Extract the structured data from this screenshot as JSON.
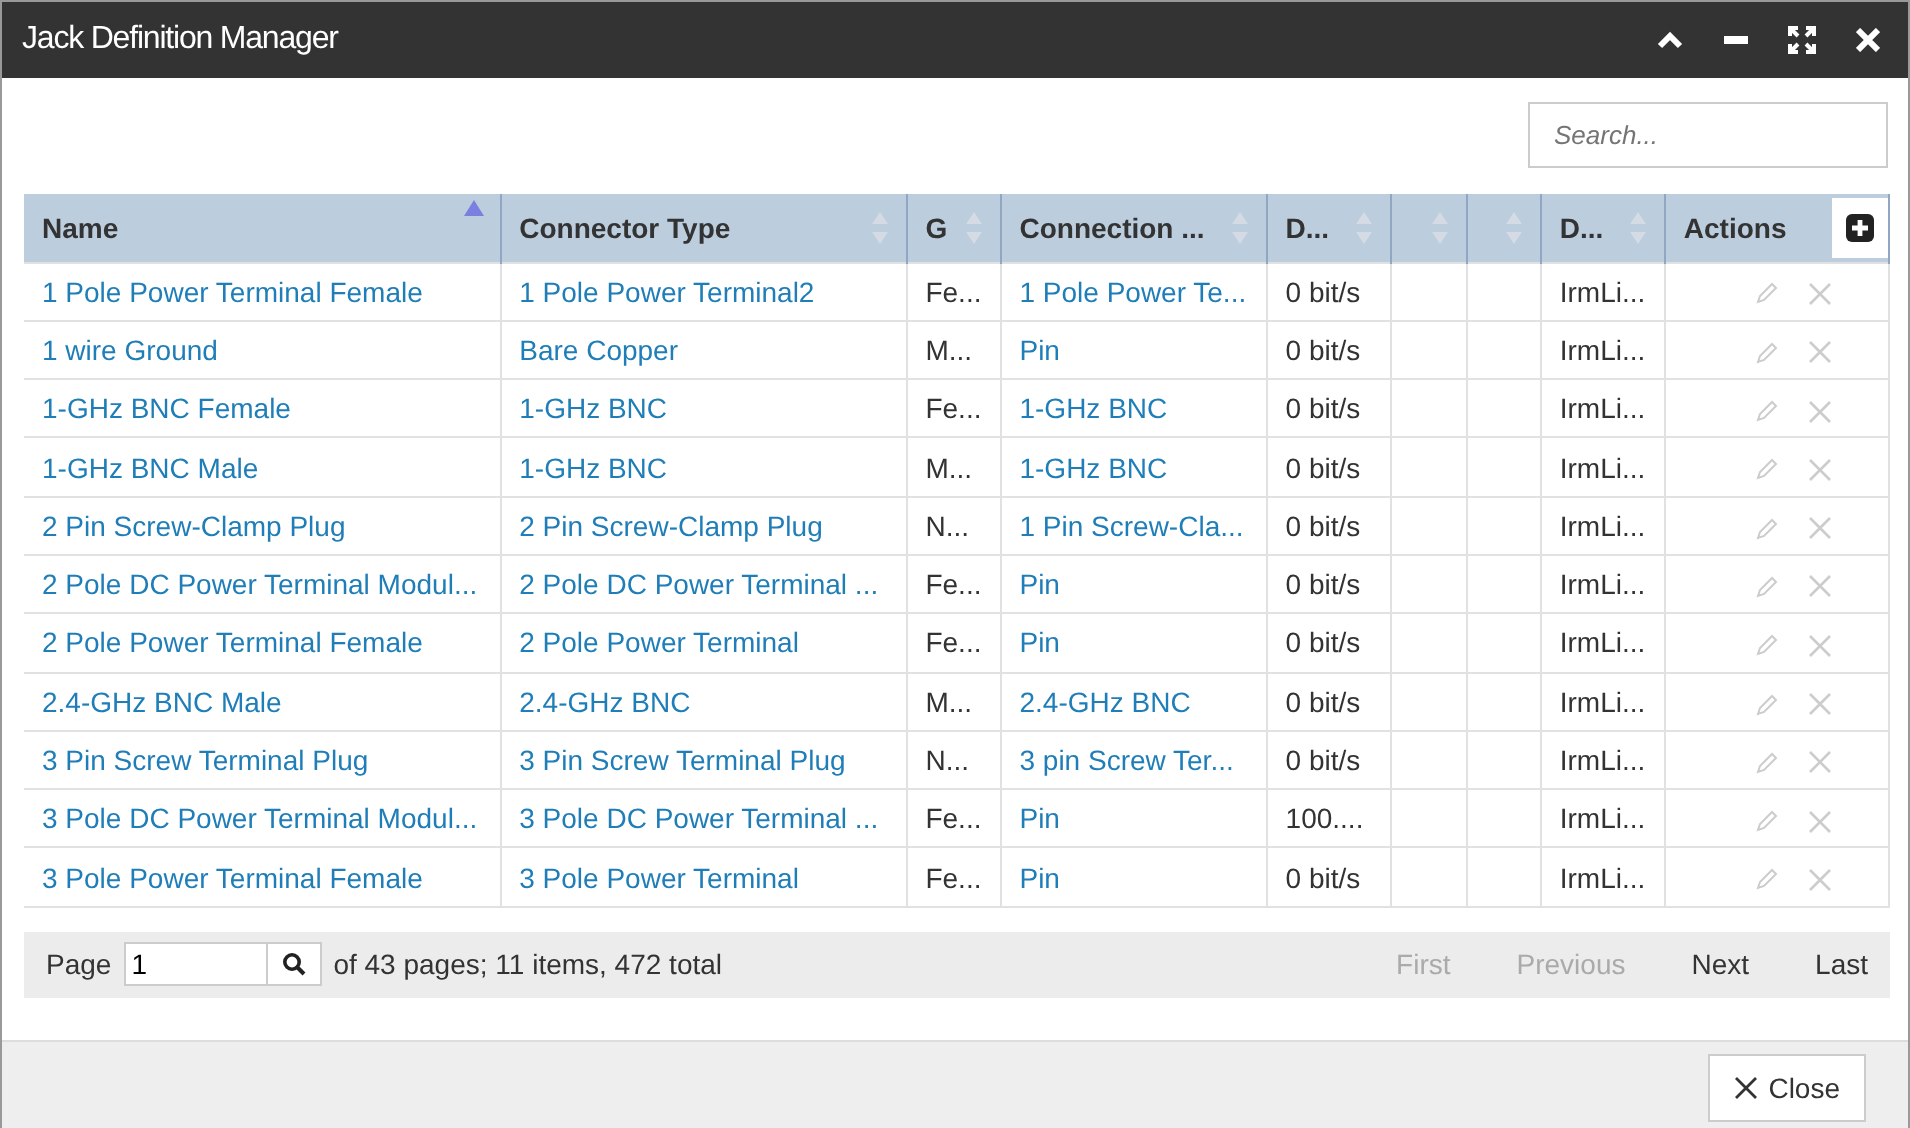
{
  "window": {
    "title": "Jack Definition Manager"
  },
  "search": {
    "placeholder": "Search..."
  },
  "table": {
    "columns": [
      {
        "label": "Name",
        "kind": "link",
        "sorted": true
      },
      {
        "label": "Connector Type",
        "kind": "link",
        "sorted": false
      },
      {
        "label": "G",
        "kind": "text",
        "sorted": false
      },
      {
        "label": "Connection ...",
        "kind": "link",
        "sorted": false
      },
      {
        "label": "D...",
        "kind": "text",
        "sorted": false
      },
      {
        "kind": "empty",
        "sorted": false
      },
      {
        "kind": "empty",
        "sorted": false
      },
      {
        "label": "D...",
        "kind": "text",
        "sorted": false
      },
      {
        "label": "Actions",
        "kind": "actions"
      }
    ],
    "rows": [
      {
        "cells": [
          "1 Pole Power Terminal Female",
          "1 Pole Power Terminal2",
          "Fe...",
          "1 Pole Power Te...",
          "0 bit/s",
          "IrmLi..."
        ]
      },
      {
        "cells": [
          "1 wire Ground",
          "Bare Copper",
          "M...",
          "Pin",
          "0 bit/s",
          "IrmLi..."
        ]
      },
      {
        "cells": [
          "1-GHz BNC Female",
          "1-GHz BNC",
          "Fe...",
          "1-GHz BNC",
          "0 bit/s",
          "IrmLi..."
        ]
      },
      {
        "cells": [
          "1-GHz BNC Male",
          "1-GHz BNC",
          "M...",
          "1-GHz BNC",
          "0 bit/s",
          "IrmLi..."
        ]
      },
      {
        "cells": [
          "2 Pin Screw-Clamp Plug",
          "2 Pin Screw-Clamp Plug",
          "N...",
          "1 Pin Screw-Cla...",
          "0 bit/s",
          "IrmLi..."
        ]
      },
      {
        "cells": [
          "2 Pole DC Power Terminal Modul...",
          "2 Pole DC Power Terminal ...",
          "Fe...",
          "Pin",
          "0 bit/s",
          "IrmLi..."
        ]
      },
      {
        "cells": [
          "2 Pole Power Terminal Female",
          "2 Pole Power Terminal",
          "Fe...",
          "Pin",
          "0 bit/s",
          "IrmLi..."
        ]
      },
      {
        "cells": [
          "2.4-GHz BNC Male",
          "2.4-GHz BNC",
          "M...",
          "2.4-GHz BNC",
          "0 bit/s",
          "IrmLi..."
        ]
      },
      {
        "cells": [
          "3 Pin Screw Terminal Plug",
          "3 Pin Screw Terminal Plug",
          "N...",
          "3 pin Screw Ter...",
          "0 bit/s",
          "IrmLi..."
        ]
      },
      {
        "cells": [
          "3 Pole DC Power Terminal Modul...",
          "3 Pole DC Power Terminal ...",
          "Fe...",
          "Pin",
          "100....",
          "IrmLi..."
        ]
      },
      {
        "cells": [
          "3 Pole Power Terminal Female",
          "3 Pole Power Terminal",
          "Fe...",
          "Pin",
          "0 bit/s",
          "IrmLi..."
        ]
      }
    ]
  },
  "pager": {
    "label": "Page",
    "page": "1",
    "summary": "of 43 pages; 11 items, 472 total",
    "buttons": [
      {
        "label": "First",
        "disabled": true
      },
      {
        "label": "Previous",
        "disabled": true
      },
      {
        "label": "Next",
        "disabled": false
      },
      {
        "label": "Last",
        "disabled": false
      }
    ]
  },
  "footer": {
    "close_label": "Close"
  }
}
